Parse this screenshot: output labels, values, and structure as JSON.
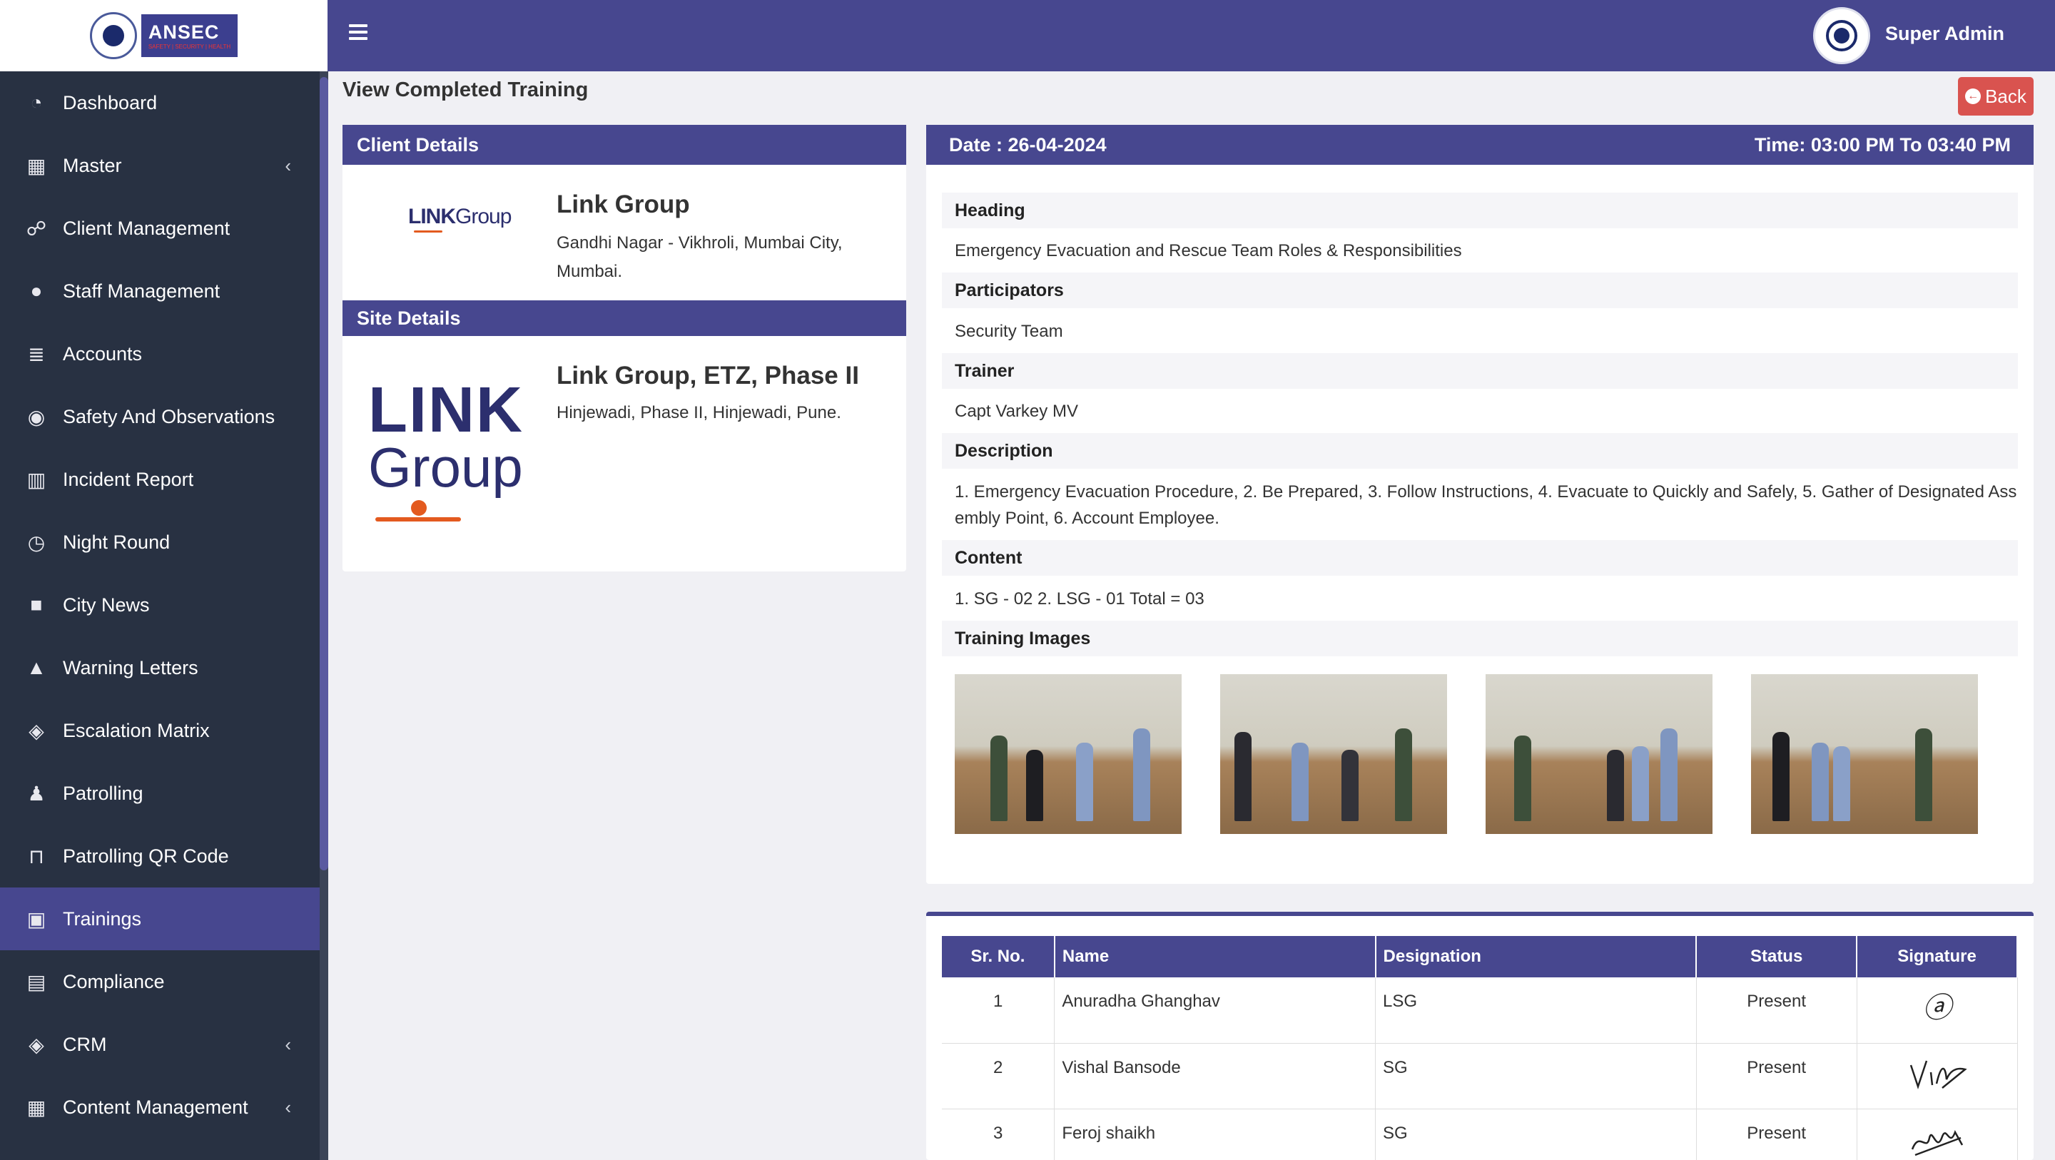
{
  "brand": {
    "name": "ANSEC",
    "tagline": "SAFETY | SECURITY | HEALTH"
  },
  "header": {
    "user_name": "Super Admin"
  },
  "sidebar": {
    "items": [
      {
        "label": "Dashboard",
        "icon": "dashboard-icon"
      },
      {
        "label": "Master",
        "icon": "table-icon",
        "has_children": true
      },
      {
        "label": "Client Management",
        "icon": "handshake-icon"
      },
      {
        "label": "Staff Management",
        "icon": "users-icon"
      },
      {
        "label": "Accounts",
        "icon": "database-icon"
      },
      {
        "label": "Safety And Observations",
        "icon": "eye-icon"
      },
      {
        "label": "Incident Report",
        "icon": "bar-chart-icon"
      },
      {
        "label": "Night Round",
        "icon": "clock-icon"
      },
      {
        "label": "City News",
        "icon": "video-icon"
      },
      {
        "label": "Warning Letters",
        "icon": "warning-icon"
      },
      {
        "label": "Escalation Matrix",
        "icon": "tag-icon"
      },
      {
        "label": "Patrolling",
        "icon": "walking-icon"
      },
      {
        "label": "Patrolling QR Code",
        "icon": "binoculars-icon"
      },
      {
        "label": "Trainings",
        "icon": "presentation-icon",
        "active": true
      },
      {
        "label": "Compliance",
        "icon": "file-icon"
      },
      {
        "label": "CRM",
        "icon": "tag-icon",
        "has_children": true
      },
      {
        "label": "Content Management",
        "icon": "table-icon",
        "has_children": true
      }
    ]
  },
  "page": {
    "title": "View Completed Training",
    "back_label": "Back"
  },
  "client": {
    "section_title": "Client Details",
    "logo_text_bold": "LINK",
    "logo_text_light": "Group",
    "name": "Link Group",
    "address": "Gandhi Nagar - Vikhroli, Mumbai City, Mumbai."
  },
  "site": {
    "section_title": "Site Details",
    "logo_line1": "LINK",
    "logo_line2": "Group",
    "name": "Link Group, ETZ, Phase II",
    "address": "Hinjewadi, Phase II, Hinjewadi, Pune."
  },
  "training": {
    "date": "Date : 26-04-2024",
    "time": "Time: 03:00 PM To 03:40 PM",
    "heading_label": "Heading",
    "heading": "Emergency Evacuation and Rescue Team Roles & Responsibilities",
    "participants_label": "Participators",
    "participants": "Security Team",
    "trainer_label": "Trainer",
    "trainer": "Capt Varkey MV",
    "description_label": "Description",
    "description": "1. Emergency Evacuation Procedure, 2. Be Prepared, 3. Follow Instructions, 4. Evacuate to Quickly and Safely, 5. Gather of Designated Assembly Point, 6. Account Employee.",
    "content_label": "Content",
    "content": "1. SG - 02 2. LSG - 01 Total = 03",
    "images_label": "Training Images"
  },
  "attendance": {
    "columns": [
      "Sr. No.",
      "Name",
      "Designation",
      "Status",
      "Signature"
    ],
    "rows": [
      {
        "sr": "1",
        "name": "Anuradha Ghanghav",
        "designation": "LSG",
        "status": "Present"
      },
      {
        "sr": "2",
        "name": "Vishal Bansode",
        "designation": "SG",
        "status": "Present"
      },
      {
        "sr": "3",
        "name": "Feroj shaikh",
        "designation": "SG",
        "status": "Present"
      }
    ]
  },
  "colors": {
    "primary": "#47478f",
    "sidebar": "#283142",
    "danger": "#d9534f",
    "logo_accent": "#e35a1f"
  }
}
